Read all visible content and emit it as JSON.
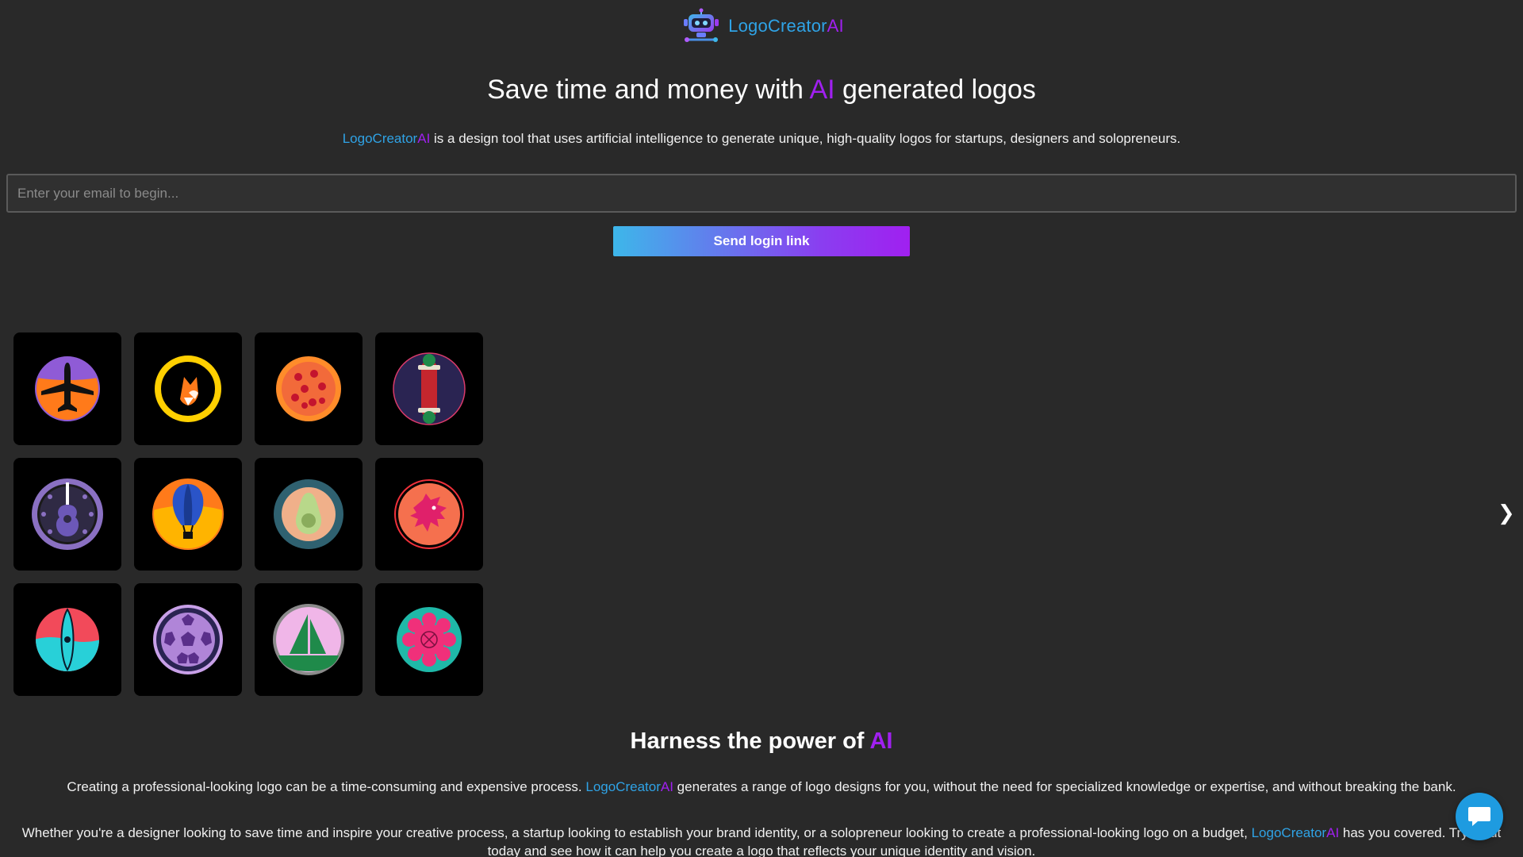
{
  "brand": {
    "name_part1": "LogoCreator",
    "name_part2": "AI",
    "logo_icon": "robot-icon",
    "colors": {
      "blue": "#2fa3e6",
      "purple": "#a020f0",
      "background": "#292929"
    }
  },
  "hero": {
    "title_before": "Save time and money with ",
    "title_highlight": "AI",
    "title_after": " generated logos",
    "desc_brand_part1": "LogoCreator",
    "desc_brand_part2": "AI",
    "desc_rest": " is a design tool that uses artificial intelligence to generate unique, high-quality logos for startups, designers and solopreneurs."
  },
  "signup": {
    "email_placeholder": "Enter your email to begin...",
    "email_value": "",
    "button_label": "Send login link"
  },
  "carousel": {
    "prev_label": "❮",
    "next_label": "❯",
    "tiles": [
      {
        "icon": "airplane-logo-icon"
      },
      {
        "icon": "fox-logo-icon"
      },
      {
        "icon": "pizza-logo-icon"
      },
      {
        "icon": "skateboard-logo-icon"
      },
      {
        "icon": "guitar-logo-icon"
      },
      {
        "icon": "hot-air-balloon-logo-icon"
      },
      {
        "icon": "avocado-logo-icon"
      },
      {
        "icon": "dragon-logo-icon"
      },
      {
        "icon": "kayak-logo-icon"
      },
      {
        "icon": "soccer-ball-logo-icon"
      },
      {
        "icon": "sailboat-logo-icon"
      },
      {
        "icon": "flower-logo-icon"
      }
    ]
  },
  "features": {
    "title_before": "Harness the power of ",
    "title_highlight": "AI",
    "para1_before": "Creating a professional-looking logo can be a time-consuming and expensive process. ",
    "para1_brand_part1": "LogoCreator",
    "para1_brand_part2": "AI",
    "para1_after": " generates a range of logo designs for you, without the need for specialized knowledge or expertise, and without breaking the bank.",
    "para2_before": "Whether you're a designer looking to save time and inspire your creative process, a startup looking to establish your brand identity, or a solopreneur looking to create a professional-looking logo on a budget, ",
    "para2_brand_part1": "LogoCreator",
    "para2_brand_part2": "AI",
    "para2_after": " has you covered. Try it out today and see how it can help you create a logo that reflects your unique identity and vision."
  },
  "chat": {
    "icon": "chat-bubble-icon"
  }
}
